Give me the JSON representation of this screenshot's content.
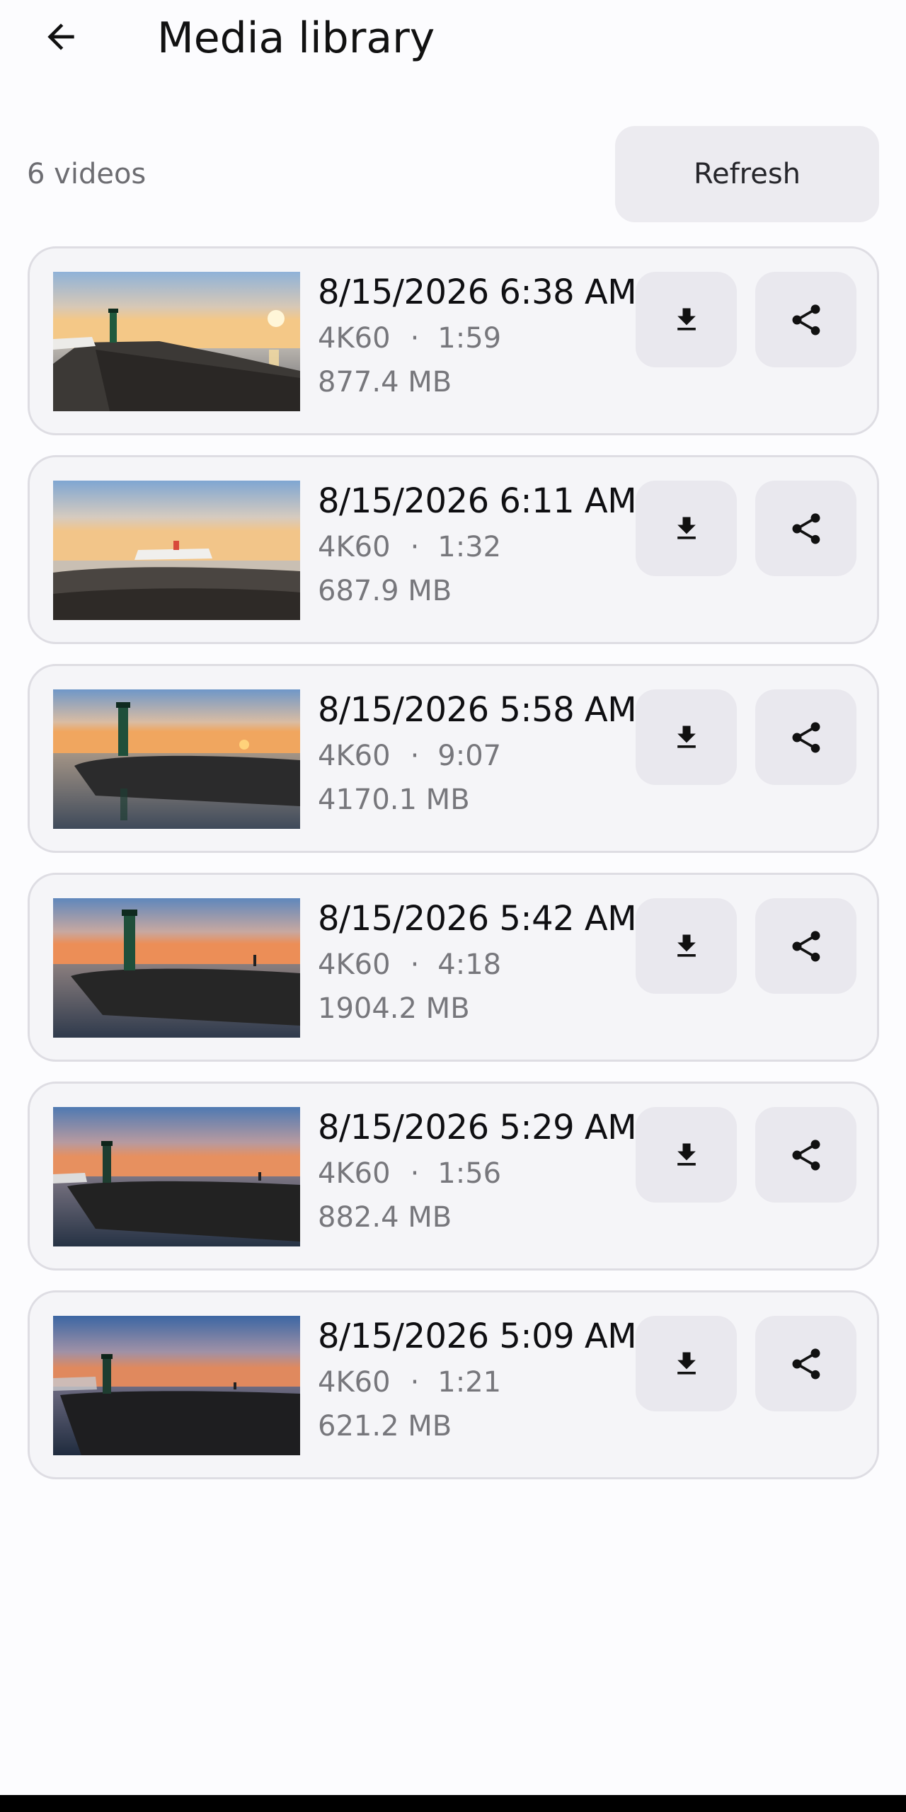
{
  "header": {
    "title": "Media library",
    "back_icon": "arrow-left-icon"
  },
  "summary": {
    "count_label": "6 videos",
    "refresh_label": "Refresh"
  },
  "videos": [
    {
      "date": "8/15/2026 6:38 AM",
      "quality": "4K60",
      "separator": "·",
      "duration": "1:59",
      "size": "877.4 MB"
    },
    {
      "date": "8/15/2026 6:11 AM",
      "quality": "4K60",
      "separator": "·",
      "duration": "1:32",
      "size": "687.9 MB"
    },
    {
      "date": "8/15/2026 5:58 AM",
      "quality": "4K60",
      "separator": "·",
      "duration": "9:07",
      "size": "4170.1 MB"
    },
    {
      "date": "8/15/2026 5:42 AM",
      "quality": "4K60",
      "separator": "·",
      "duration": "4:18",
      "size": "1904.2 MB"
    },
    {
      "date": "8/15/2026 5:29 AM",
      "quality": "4K60",
      "separator": "·",
      "duration": "1:56",
      "size": "882.4 MB"
    },
    {
      "date": "8/15/2026 5:09 AM",
      "quality": "4K60",
      "separator": "·",
      "duration": "1:21",
      "size": "621.2 MB"
    }
  ],
  "icons": {
    "download": "download-icon",
    "share": "share-icon"
  },
  "colors": {
    "background": "#fcfcfe",
    "card": "#f5f5f8",
    "card_border": "#dedde3",
    "button": "#e9e8ee",
    "secondary_text": "#77777c"
  }
}
